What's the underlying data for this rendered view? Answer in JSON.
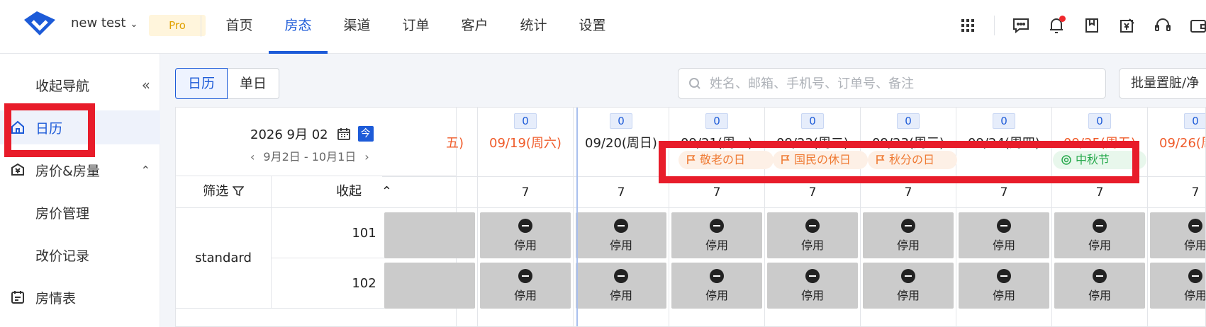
{
  "header": {
    "hotel_name": "new test",
    "plan_badge": "Pro",
    "nav": [
      "首页",
      "房态",
      "渠道",
      "订单",
      "客户",
      "统计",
      "设置"
    ],
    "active_nav": "房态",
    "icons": [
      "apps-grid-icon",
      "message-icon",
      "bell-icon",
      "book-icon",
      "yen-receipt-icon",
      "headset-icon",
      "wallet-icon"
    ],
    "has_notification": true
  },
  "sidebar": {
    "collapse_label": "收起导航",
    "items": {
      "calendar": "日历",
      "rates": "房价&房量",
      "rate_manage": "房价管理",
      "rate_log": "改价记录",
      "room_status": "房情表"
    }
  },
  "toolbar": {
    "view_calendar": "日历",
    "view_single": "单日",
    "search_placeholder": "姓名、邮箱、手机号、订单号、备注",
    "batch_label": "批量置脏/净"
  },
  "calendar": {
    "current_date": "2026 9月 02",
    "today_btn": "今",
    "range": "9月2日 - 10月1日",
    "filter_label": "筛选",
    "fold_label": "收起",
    "room_type": "standard",
    "rooms": [
      "101",
      "102"
    ],
    "partial_label": "五)",
    "columns": [
      {
        "badge": "0",
        "label": "09/19(周六)",
        "weekend": true,
        "count": "7"
      },
      {
        "badge": "0",
        "label": "09/20(周日)",
        "weekend": false,
        "count": "7"
      },
      {
        "badge": "0",
        "label": "09/21(周一)",
        "weekend": false,
        "count": "7"
      },
      {
        "badge": "0",
        "label": "09/22(周二)",
        "weekend": false,
        "count": "7"
      },
      {
        "badge": "0",
        "label": "09/23(周三)",
        "weekend": false,
        "count": "7"
      },
      {
        "badge": "0",
        "label": "09/24(周四)",
        "weekend": false,
        "count": "7"
      },
      {
        "badge": "0",
        "label": "09/25(周五)",
        "weekend": true,
        "count": "7"
      },
      {
        "badge": "0",
        "label": "09/26(周六)",
        "weekend": true,
        "count": "7"
      }
    ],
    "holidays": [
      "敬老の日",
      "国民の休日",
      "秋分の日",
      "中秋节"
    ],
    "status_label": "停用"
  },
  "colors": {
    "primary": "#1d5bd8",
    "weekend": "#ef5b2a",
    "jp_holiday": "#ef7a33",
    "cn_holiday": "#26a94b",
    "annotation_red": "#e81c2a"
  }
}
